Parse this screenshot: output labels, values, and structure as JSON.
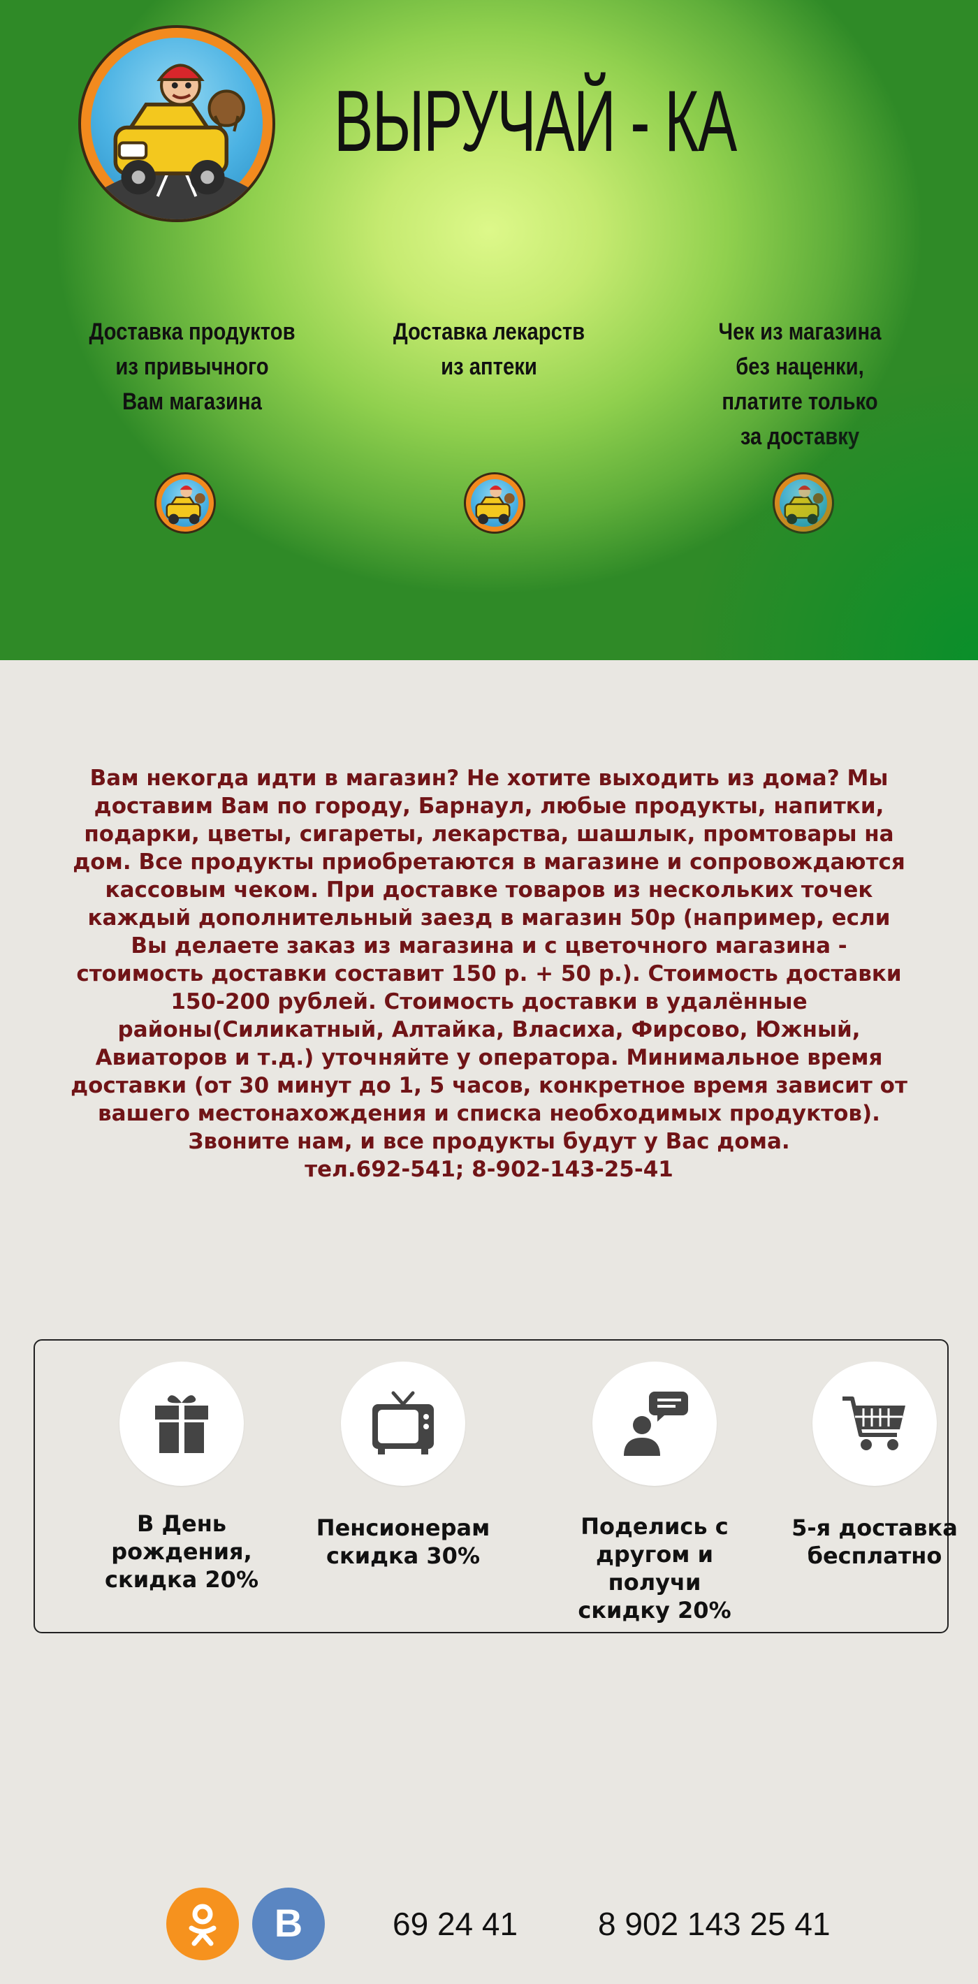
{
  "header": {
    "brand": "ВЫРУЧАЙ - КА",
    "logo_icon": "delivery-mascot-car-icon"
  },
  "features": [
    {
      "text": "Доставка продуктов\nиз привычного\nВам магазина",
      "icon": "delivery-mascot-car-icon"
    },
    {
      "text": "Доставка лекарств\nиз аптеки",
      "icon": "delivery-mascot-car-icon"
    },
    {
      "text": "Чек из магазина\nбез наценки,\nплатите только\nза доставку",
      "icon": "delivery-mascot-car-icon"
    }
  ],
  "description": {
    "text": "Вам некогда идти в магазин? Не хотите выходить из дома? Мы доставим Вам по городу, Барнаул, любые продукты, напитки, подарки, цветы, сигареты, лекарства, шашлык, промтовары на дом. Все продукты приобретаются в магазине и сопровождаются кассовым чеком. При доставке товаров из нескольких точек каждый дополнительный заезд в магазин 50р (например, если Вы делаете заказ из магазина и с цветочного магазина - стоимость доставки составит 150 р. + 50 р.). Стоимость доставки 150-200 рублей. Стоимость доставки в удалённые районы(Силикатный, Алтайка, Власиха, Фирсово, Южный, Авиаторов и т.д.) уточняйте у оператора. Минимальное время доставки (от 30 минут до 1, 5 часов, конкретное время зависит от вашего местонахождения и списка необходимых продуктов). Звоните нам, и все продукты будут у Вас дома.",
    "phone_line": "тел.692-541; 8-902-143-25-41",
    "color": "#701417"
  },
  "promos": [
    {
      "icon": "gift-icon",
      "text": "В День\nрождения,\nскидка 20%"
    },
    {
      "icon": "tv-icon",
      "text": "Пенсионерам\nскидка 30%"
    },
    {
      "icon": "share-chat-icon",
      "text": "Поделись с\nдругом и\nполучи\nскидку 20%"
    },
    {
      "icon": "cart-icon",
      "text": "5-я доставка\nбесплатно"
    }
  ],
  "footer": {
    "social": [
      {
        "icon": "odnoklassniki-icon",
        "color": "#f6921e"
      },
      {
        "icon": "vk-icon",
        "color": "#5a86c2",
        "label": "В"
      }
    ],
    "phones": [
      "69 24 41",
      "8 902 143 25 41"
    ]
  }
}
